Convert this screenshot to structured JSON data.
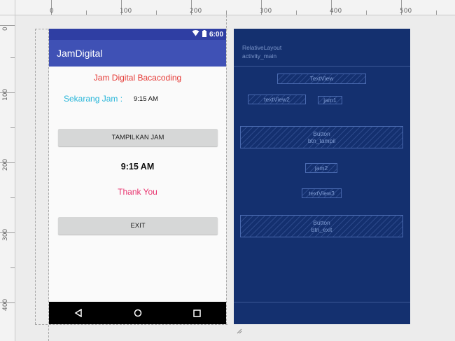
{
  "ruler": {
    "h_labels": [
      "0",
      "100",
      "200",
      "300",
      "400",
      "500"
    ],
    "v_labels": [
      "0",
      "100",
      "200",
      "300",
      "400"
    ]
  },
  "phone": {
    "status_time": "6:00",
    "app_title": "JamDigital",
    "title_text": "Jam Digital Bacacoding",
    "label_now": "Sekarang Jam :",
    "time_small": "9:15 AM",
    "button_show": "TAMPILKAN JAM",
    "time_big": "9:15 AM",
    "thanks": "Thank You",
    "button_exit": "EXIT"
  },
  "blueprint": {
    "layout_type": "RelativeLayout",
    "layout_id": "activity_main",
    "textview": "TextView",
    "textview2": "textView2",
    "jam1": "jam1",
    "btn_tampil_type": "Button",
    "btn_tampil_id": "btn_tampil",
    "jam2": "jam2",
    "textview3": "textView3",
    "btn_exit_type": "Button",
    "btn_exit_id": "btn_exit"
  },
  "colors": {
    "statusbar": "#2f3ea3",
    "appbar": "#3f51b5",
    "title_red": "#e53935",
    "label_blue": "#29b6d9",
    "thanks_pink": "#e8336e",
    "blueprint_bg": "#14306f"
  }
}
